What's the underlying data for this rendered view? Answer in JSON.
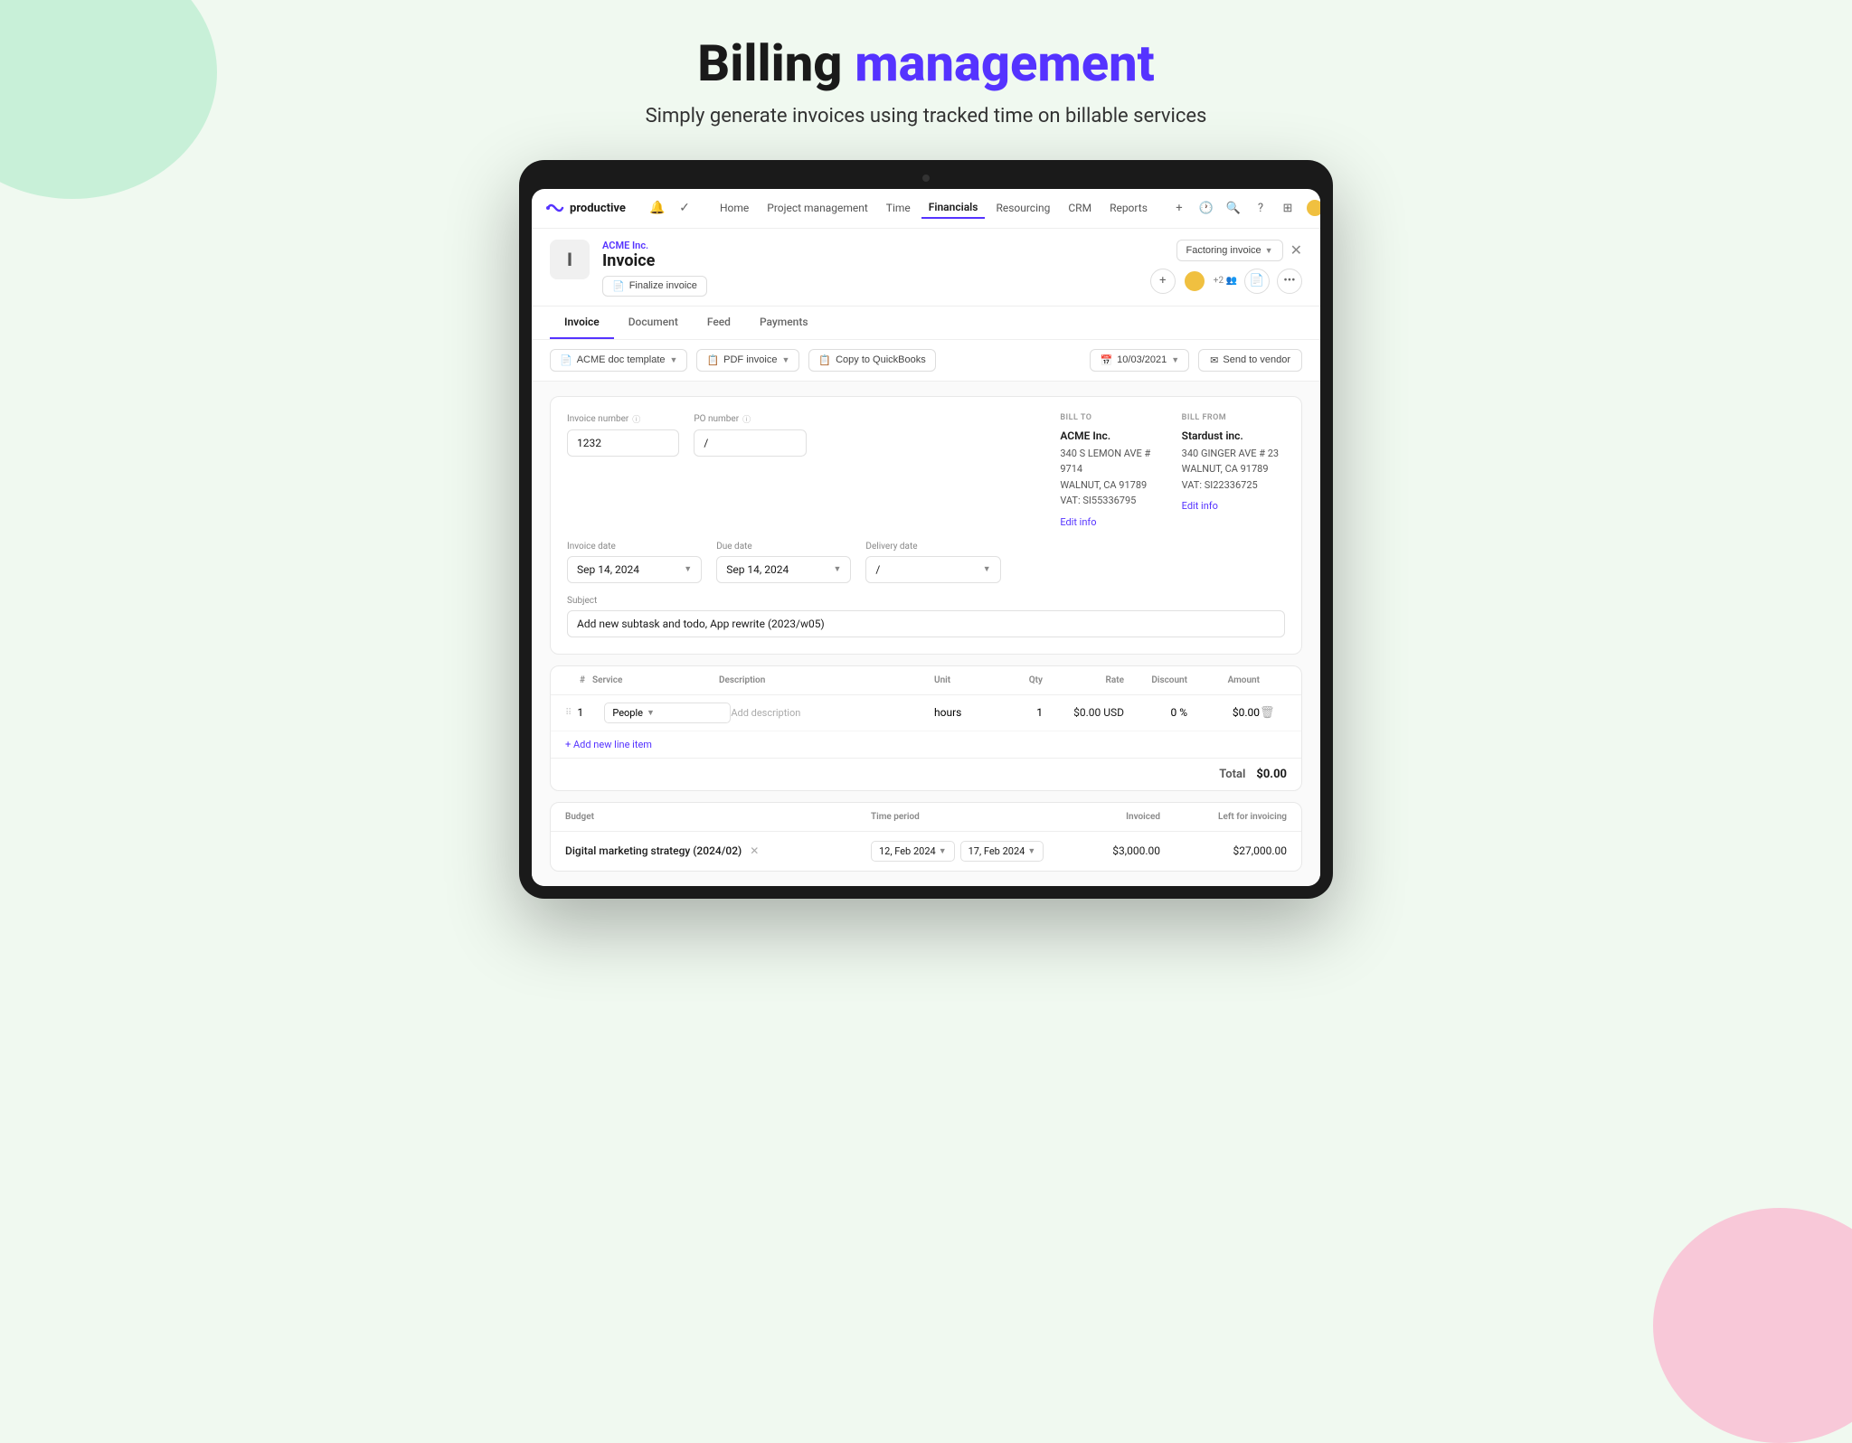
{
  "hero": {
    "title_regular": "Billing",
    "title_accent": "management",
    "subtitle": "Simply generate invoices using tracked time on billable services"
  },
  "nav": {
    "logo_text": "productive",
    "items": [
      {
        "label": "Home",
        "active": false
      },
      {
        "label": "Project management",
        "active": false
      },
      {
        "label": "Time",
        "active": false
      },
      {
        "label": "Financials",
        "active": true
      },
      {
        "label": "Resourcing",
        "active": false
      },
      {
        "label": "CRM",
        "active": false
      },
      {
        "label": "Reports",
        "active": false
      }
    ]
  },
  "invoice_header": {
    "logo_text": "I",
    "company_name": "ACME Inc.",
    "invoice_label": "Invoice",
    "finalize_btn": "Finalize invoice",
    "factoring_btn": "Factoring invoice",
    "tabs": [
      {
        "label": "Invoice",
        "active": true
      },
      {
        "label": "Document",
        "active": false
      },
      {
        "label": "Feed",
        "active": false
      },
      {
        "label": "Payments",
        "active": false
      }
    ]
  },
  "toolbar": {
    "doc_template_btn": "ACME doc template",
    "pdf_btn": "PDF invoice",
    "quickbooks_btn": "Copy to QuickBooks",
    "date_btn": "10/03/2021",
    "send_btn": "Send to vendor"
  },
  "invoice_form": {
    "invoice_number_label": "Invoice number",
    "invoice_number_value": "1232",
    "po_number_label": "PO number",
    "po_number_value": "/",
    "invoice_date_label": "Invoice date",
    "invoice_date_value": "Sep 14, 2024",
    "due_date_label": "Due date",
    "due_date_value": "Sep 14, 2024",
    "delivery_date_label": "Delivery date",
    "delivery_date_value": "/",
    "subject_label": "Subject",
    "subject_value": "Add new subtask and todo, App rewrite (2023/w05)"
  },
  "bill_to": {
    "label": "BILL TO",
    "company": "ACME Inc.",
    "address_line1": "340 S LEMON AVE # 9714",
    "address_line2": "WALNUT, CA 91789",
    "vat": "VAT: SI55336795",
    "edit_link": "Edit info"
  },
  "bill_from": {
    "label": "BILL FROM",
    "company": "Stardust inc.",
    "address_line1": "340 GINGER AVE # 23",
    "address_line2": "WALNUT, CA 91789",
    "vat": "VAT: SI22336725",
    "edit_link": "Edit info"
  },
  "line_items": {
    "columns": [
      "#",
      "Service",
      "Description",
      "Unit",
      "Qty",
      "Rate",
      "Discount",
      "Amount"
    ],
    "rows": [
      {
        "number": "1",
        "service": "People",
        "description": "Add description",
        "unit": "hours",
        "qty": "1",
        "rate": "$0.00 USD",
        "discount": "0 %",
        "amount": "$0.00"
      }
    ],
    "add_btn": "+ Add new line item",
    "total_label": "Total",
    "total_value": "$0.00"
  },
  "budget": {
    "columns": [
      "Budget",
      "Time period",
      "Invoiced",
      "Left for invoicing"
    ],
    "rows": [
      {
        "name": "Digital marketing strategy (2024/02)",
        "period_from": "12, Feb 2024",
        "period_to": "17, Feb 2024",
        "invoiced": "$3,000.00",
        "left": "$27,000.00"
      }
    ]
  },
  "colors": {
    "accent": "#5533ff",
    "text_dark": "#1a1a1a",
    "text_mid": "#555",
    "border": "#e8e8e8"
  }
}
